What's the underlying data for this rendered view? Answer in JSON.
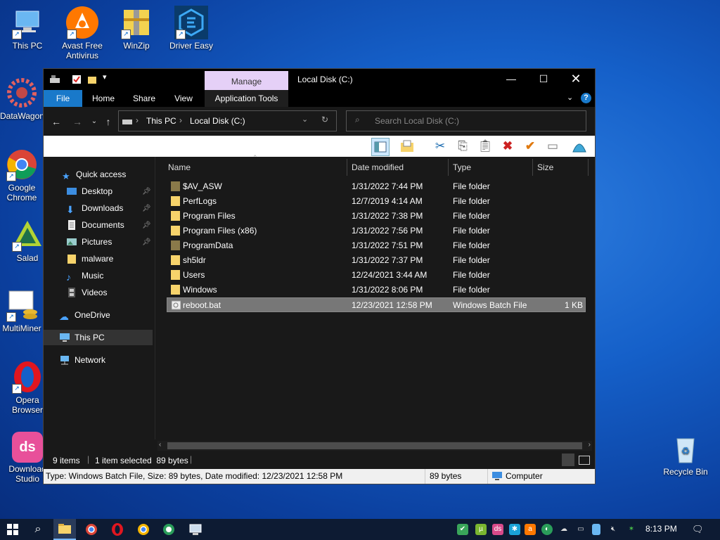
{
  "desktop": {
    "icons": [
      {
        "label": "This PC"
      },
      {
        "label": "Avast Free Antivirus"
      },
      {
        "label": "WinZip"
      },
      {
        "label": "Driver Easy"
      },
      {
        "label": "DataWagon"
      },
      {
        "label": "Google Chrome"
      },
      {
        "label": "Salad"
      },
      {
        "label": "MultiMiner"
      },
      {
        "label": "Opera Browser"
      },
      {
        "label": "Download Studio"
      },
      {
        "label": "Recycle Bin"
      }
    ]
  },
  "window": {
    "title": "Local Disk (C:)",
    "manage_label": "Manage",
    "tabs": [
      "File",
      "Home",
      "Share",
      "View",
      "Application Tools"
    ],
    "address": {
      "parts": [
        "This PC",
        "Local Disk (C:)"
      ]
    },
    "search_placeholder": "Search Local Disk (C:)",
    "nav": {
      "quick_access": "Quick access",
      "items": [
        "Desktop",
        "Downloads",
        "Documents",
        "Pictures",
        "malware",
        "Music",
        "Videos"
      ],
      "onedrive": "OneDrive",
      "this_pc": "This PC",
      "network": "Network"
    },
    "columns": [
      "Name",
      "Date modified",
      "Type",
      "Size"
    ],
    "files": [
      {
        "name": "$AV_ASW",
        "date": "1/31/2022 7:44 PM",
        "type": "File folder",
        "size": ""
      },
      {
        "name": "PerfLogs",
        "date": "12/7/2019 4:14 AM",
        "type": "File folder",
        "size": ""
      },
      {
        "name": "Program Files",
        "date": "1/31/2022 7:38 PM",
        "type": "File folder",
        "size": ""
      },
      {
        "name": "Program Files (x86)",
        "date": "1/31/2022 7:56 PM",
        "type": "File folder",
        "size": ""
      },
      {
        "name": "ProgramData",
        "date": "1/31/2022 7:51 PM",
        "type": "File folder",
        "size": ""
      },
      {
        "name": "sh5ldr",
        "date": "1/31/2022 7:37 PM",
        "type": "File folder",
        "size": ""
      },
      {
        "name": "Users",
        "date": "12/24/2021 3:44 AM",
        "type": "File folder",
        "size": ""
      },
      {
        "name": "Windows",
        "date": "1/31/2022 8:06 PM",
        "type": "File folder",
        "size": ""
      },
      {
        "name": "reboot.bat",
        "date": "12/23/2021 12:58 PM",
        "type": "Windows Batch File",
        "size": "1 KB"
      }
    ],
    "status": {
      "items": "9 items",
      "selected": "1 item selected  89 bytes"
    },
    "details": {
      "info": "Type: Windows Batch File, Size: 89 bytes, Date modified: 12/23/2021 12:58 PM",
      "size": "89 bytes",
      "location": "Computer"
    }
  },
  "taskbar": {
    "clock": "8:13 PM"
  }
}
